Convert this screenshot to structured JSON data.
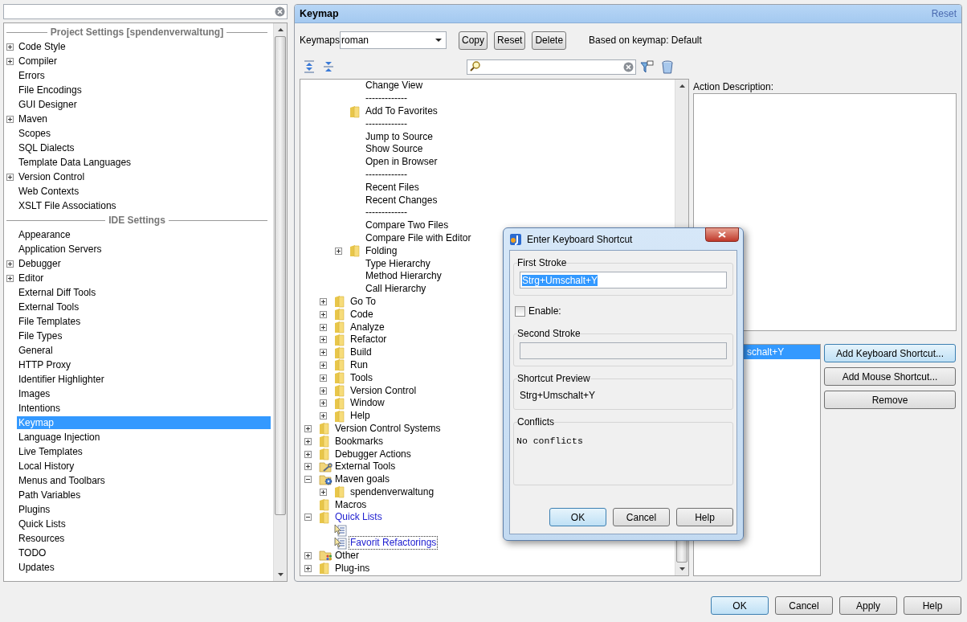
{
  "sidebar": {
    "sections": [
      {
        "title": "Project Settings [spendenverwaltung]",
        "items": [
          {
            "label": "Code Style",
            "expanded": false,
            "selected": false
          },
          {
            "label": "Compiler",
            "expanded": false,
            "selected": false
          },
          {
            "label": "Errors",
            "selected": false
          },
          {
            "label": "File Encodings",
            "selected": false
          },
          {
            "label": "GUI Designer",
            "selected": false
          },
          {
            "label": "Maven",
            "expanded": false,
            "selected": false
          },
          {
            "label": "Scopes",
            "selected": false
          },
          {
            "label": "SQL Dialects",
            "selected": false
          },
          {
            "label": "Template Data Languages",
            "selected": false
          },
          {
            "label": "Version Control",
            "expanded": false,
            "selected": false
          },
          {
            "label": "Web Contexts",
            "selected": false
          },
          {
            "label": "XSLT File Associations",
            "selected": false
          }
        ]
      },
      {
        "title": "IDE Settings",
        "items": [
          {
            "label": "Appearance",
            "selected": false
          },
          {
            "label": "Application Servers",
            "selected": false
          },
          {
            "label": "Debugger",
            "expanded": false,
            "selected": false
          },
          {
            "label": "Editor",
            "expanded": false,
            "selected": false
          },
          {
            "label": "External Diff Tools",
            "selected": false
          },
          {
            "label": "External Tools",
            "selected": false
          },
          {
            "label": "File Templates",
            "selected": false
          },
          {
            "label": "File Types",
            "selected": false
          },
          {
            "label": "General",
            "selected": false
          },
          {
            "label": "HTTP Proxy",
            "selected": false
          },
          {
            "label": "Identifier Highlighter",
            "selected": false
          },
          {
            "label": "Images",
            "selected": false
          },
          {
            "label": "Intentions",
            "selected": false
          },
          {
            "label": "Keymap",
            "selected": true
          },
          {
            "label": "Language Injection",
            "selected": false
          },
          {
            "label": "Live Templates",
            "selected": false
          },
          {
            "label": "Local History",
            "selected": false
          },
          {
            "label": "Menus and Toolbars",
            "selected": false
          },
          {
            "label": "Path Variables",
            "selected": false
          },
          {
            "label": "Plugins",
            "selected": false
          },
          {
            "label": "Quick Lists",
            "selected": false
          },
          {
            "label": "Resources",
            "selected": false
          },
          {
            "label": "TODO",
            "selected": false
          },
          {
            "label": "Updates",
            "selected": false
          }
        ]
      }
    ]
  },
  "panel": {
    "title": "Keymap",
    "reset_link": "Reset"
  },
  "keymap_row": {
    "label": "Keymaps",
    "value": "roman",
    "buttons": [
      "Copy",
      "Reset",
      "Delete"
    ],
    "based_on": "Based on keymap: Default"
  },
  "tree": {
    "items": [
      {
        "children": [
          {
            "children": [
              {
                "label": "Change View"
              },
              {
                "label": "-------------"
              },
              {
                "label": "Add To Favorites",
                "kind": "folder"
              },
              {
                "label": "-------------"
              },
              {
                "label": "Jump to Source"
              },
              {
                "label": "Show Source"
              },
              {
                "label": "Open in Browser"
              },
              {
                "label": "-------------"
              },
              {
                "label": "Recent Files"
              },
              {
                "label": "Recent Changes"
              },
              {
                "label": "-------------"
              },
              {
                "label": "Compare Two Files"
              },
              {
                "label": "Compare File with Editor"
              },
              {
                "label": "Folding",
                "kind": "folder",
                "expanded": false
              },
              {
                "label": "Type Hierarchy"
              },
              {
                "label": "Method Hierarchy"
              },
              {
                "label": "Call Hierarchy"
              }
            ]
          },
          {
            "label": "Go To",
            "kind": "folder",
            "expanded": false
          },
          {
            "label": "Code",
            "kind": "folder",
            "expanded": false
          },
          {
            "label": "Analyze",
            "kind": "folder",
            "expanded": false
          },
          {
            "label": "Refactor",
            "kind": "folder",
            "expanded": false
          },
          {
            "label": "Build",
            "kind": "folder",
            "expanded": false
          },
          {
            "label": "Run",
            "kind": "folder",
            "expanded": false
          },
          {
            "label": "Tools",
            "kind": "folder",
            "expanded": false
          },
          {
            "label": "Version Control",
            "kind": "folder",
            "expanded": false
          },
          {
            "label": "Window",
            "kind": "folder",
            "expanded": false
          },
          {
            "label": "Help",
            "kind": "folder",
            "expanded": false
          }
        ]
      },
      {
        "label": "Version Control Systems",
        "kind": "folder",
        "expanded": false
      },
      {
        "label": "Bookmarks",
        "kind": "folder",
        "expanded": false
      },
      {
        "label": "Debugger Actions",
        "kind": "folder",
        "expanded": false
      },
      {
        "label": "External Tools",
        "kind": "tools-folder",
        "expanded": false
      },
      {
        "label": "Maven goals",
        "kind": "gear-folder",
        "expanded": true,
        "children": [
          {
            "label": "spendenverwaltung",
            "kind": "folder",
            "expanded": false
          }
        ]
      },
      {
        "label": "Macros",
        "kind": "folder"
      },
      {
        "label": "Quick Lists",
        "kind": "folder",
        "expanded": true,
        "modified": true,
        "children": [
          {
            "kind": "quick-list"
          },
          {
            "label": "Favorit Refactorings",
            "kind": "quick-list",
            "modified": true,
            "focused": true
          }
        ]
      },
      {
        "label": "Other",
        "kind": "other-folder",
        "expanded": false
      },
      {
        "label": "Plug-ins",
        "kind": "folder",
        "expanded": false
      }
    ]
  },
  "action_description": {
    "label": "Action Description:"
  },
  "shortcuts": {
    "items": [
      {
        "label": "schalt+Y",
        "selected": true
      }
    ],
    "buttons": [
      {
        "label": "Add Keyboard Shortcut...",
        "default": true
      },
      {
        "label": "Add Mouse Shortcut...",
        "default": false
      },
      {
        "label": "Remove",
        "default": false
      }
    ]
  },
  "dialog": {
    "title": "Enter Keyboard Shortcut",
    "first_stroke": {
      "legend": "First Stroke",
      "value": "Strg+Umschalt+Y",
      "selected": true
    },
    "enable": {
      "label": "Enable:",
      "checked": false
    },
    "second_stroke": {
      "legend": "Second Stroke"
    },
    "preview": {
      "legend": "Shortcut Preview",
      "text": "Strg+Umschalt+Y"
    },
    "conflicts": {
      "legend": "Conflicts",
      "text": "No conflicts"
    },
    "buttons": [
      {
        "label": "OK",
        "default": true
      },
      {
        "label": "Cancel",
        "default": false
      },
      {
        "label": "Help",
        "default": false
      }
    ]
  },
  "footer": {
    "buttons": [
      {
        "label": "OK",
        "default": true
      },
      {
        "label": "Cancel",
        "default": false
      },
      {
        "label": "Apply",
        "default": false
      },
      {
        "label": "Help",
        "default": false
      }
    ]
  }
}
